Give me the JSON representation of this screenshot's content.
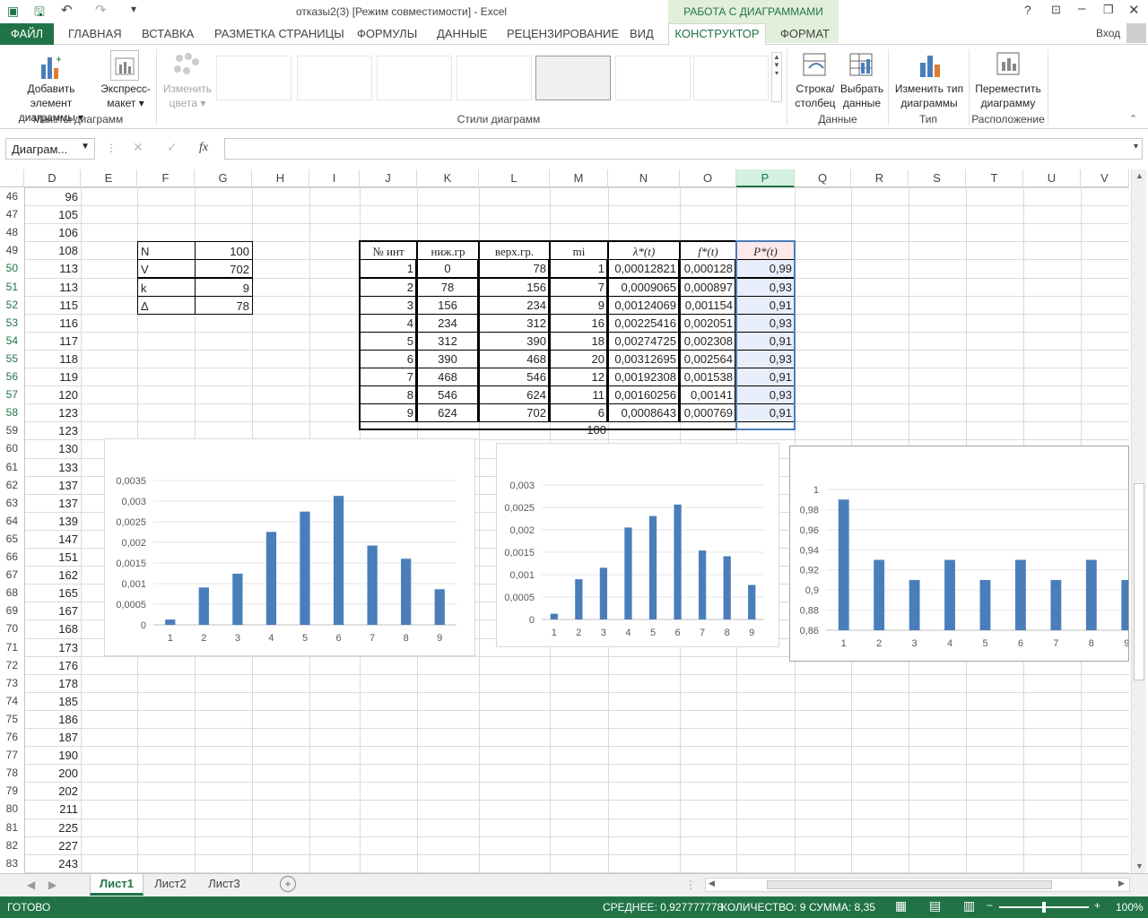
{
  "window": {
    "title": "отказы2(3)  [Режим совместимости] - Excel",
    "context_group": "РАБОТА С ДИАГРАММАМИ",
    "signin": "Вход"
  },
  "tabs": [
    "ФАЙЛ",
    "ГЛАВНАЯ",
    "ВСТАВКА",
    "РАЗМЕТКА СТРАНИЦЫ",
    "ФОРМУЛЫ",
    "ДАННЫЕ",
    "РЕЦЕНЗИРОВАНИЕ",
    "ВИД",
    "КОНСТРУКТОР",
    "ФОРМАТ"
  ],
  "ribbon": {
    "add_element": [
      "Добавить элемент",
      "диаграммы"
    ],
    "express": [
      "Экспресс-",
      "макет"
    ],
    "change_colors": [
      "Изменить",
      "цвета"
    ],
    "row_col": [
      "Строка/",
      "столбец"
    ],
    "select_data": [
      "Выбрать",
      "данные"
    ],
    "change_type": [
      "Изменить тип",
      "диаграммы"
    ],
    "move_chart": [
      "Переместить",
      "диаграмму"
    ],
    "groups": {
      "layouts": "Макеты диаграмм",
      "styles": "Стили диаграмм",
      "data": "Данные",
      "type": "Тип",
      "location": "Расположение"
    }
  },
  "formula_bar": {
    "name_box": "Диаграм...",
    "fx": "fx",
    "value": ""
  },
  "columns": [
    "D",
    "E",
    "F",
    "G",
    "H",
    "I",
    "J",
    "K",
    "L",
    "M",
    "N",
    "O",
    "P",
    "Q",
    "R",
    "S",
    "T",
    "U",
    "V"
  ],
  "rows": [
    46,
    47,
    48,
    49,
    50,
    51,
    52,
    53,
    54,
    55,
    56,
    57,
    58,
    59,
    60,
    61,
    62,
    63,
    64,
    65,
    66,
    67,
    68,
    69,
    70,
    71,
    72,
    73,
    74,
    75,
    76,
    77,
    78,
    79,
    80,
    81,
    82,
    83
  ],
  "col_d_values": [
    "96",
    "105",
    "106",
    "108",
    "113",
    "113",
    "115",
    "116",
    "117",
    "118",
    "119",
    "120",
    "123",
    "123",
    "130",
    "133",
    "137",
    "137",
    "139",
    "147",
    "151",
    "162",
    "165",
    "167",
    "168",
    "173",
    "176",
    "178",
    "185",
    "186",
    "187",
    "190",
    "200",
    "202",
    "211",
    "225",
    "227",
    "243"
  ],
  "params": [
    [
      "N",
      "100"
    ],
    [
      "V",
      "702"
    ],
    [
      "k",
      "9"
    ],
    [
      "Δ",
      "78"
    ]
  ],
  "table": {
    "headers": [
      "№ инт",
      "ниж.гр",
      "верх.гр.",
      "mi",
      "λ*(t)",
      "f*(t)",
      "P*(t)"
    ],
    "rows": [
      [
        "1",
        "0",
        "78",
        "1",
        "0,00012821",
        "0,000128",
        "0,99"
      ],
      [
        "2",
        "78",
        "156",
        "7",
        "0,0009065",
        "0,000897",
        "0,93"
      ],
      [
        "3",
        "156",
        "234",
        "9",
        "0,00124069",
        "0,001154",
        "0,91"
      ],
      [
        "4",
        "234",
        "312",
        "16",
        "0,00225416",
        "0,002051",
        "0,93"
      ],
      [
        "5",
        "312",
        "390",
        "18",
        "0,00274725",
        "0,002308",
        "0,91"
      ],
      [
        "6",
        "390",
        "468",
        "20",
        "0,00312695",
        "0,002564",
        "0,93"
      ],
      [
        "7",
        "468",
        "546",
        "12",
        "0,00192308",
        "0,001538",
        "0,91"
      ],
      [
        "8",
        "546",
        "624",
        "11",
        "0,00160256",
        "0,00141",
        "0,93"
      ],
      [
        "9",
        "624",
        "702",
        "6",
        "0,0008643",
        "0,000769",
        "0,91"
      ]
    ],
    "total_mi": "100"
  },
  "chart_data": [
    {
      "type": "bar",
      "categories": [
        "1",
        "2",
        "3",
        "4",
        "5",
        "6",
        "7",
        "8",
        "9"
      ],
      "values": [
        0.00012821,
        0.0009065,
        0.00124069,
        0.00225416,
        0.00274725,
        0.00312695,
        0.00192308,
        0.00160256,
        0.0008643
      ],
      "ylim": [
        0,
        0.0035
      ],
      "yticks": [
        "0",
        "0,0005",
        "0,001",
        "0,0015",
        "0,002",
        "0,0025",
        "0,003",
        "0,0035"
      ],
      "color": "#4a7ebb"
    },
    {
      "type": "bar",
      "categories": [
        "1",
        "2",
        "3",
        "4",
        "5",
        "6",
        "7",
        "8",
        "9"
      ],
      "values": [
        0.000128,
        0.000897,
        0.001154,
        0.002051,
        0.002308,
        0.002564,
        0.001538,
        0.00141,
        0.000769
      ],
      "ylim": [
        0,
        0.003
      ],
      "yticks": [
        "0",
        "0,0005",
        "0,001",
        "0,0015",
        "0,002",
        "0,0025",
        "0,003"
      ],
      "color": "#4a7ebb"
    },
    {
      "type": "bar",
      "categories": [
        "1",
        "2",
        "3",
        "4",
        "5",
        "6",
        "7",
        "8",
        "9"
      ],
      "values": [
        0.99,
        0.93,
        0.91,
        0.93,
        0.91,
        0.93,
        0.91,
        0.93,
        0.91
      ],
      "ylim": [
        0.86,
        1
      ],
      "yticks": [
        "0,86",
        "0,88",
        "0,9",
        "0,92",
        "0,94",
        "0,96",
        "0,98",
        "1"
      ],
      "color": "#4a7ebb"
    }
  ],
  "sheets": [
    "Лист1",
    "Лист2",
    "Лист3"
  ],
  "status": {
    "ready": "ГОТОВО",
    "average": "СРЕДНЕЕ: 0,927777778",
    "count": "КОЛИЧЕСТВО: 9",
    "sum": "СУММА: 8,35",
    "zoom": "100%"
  }
}
